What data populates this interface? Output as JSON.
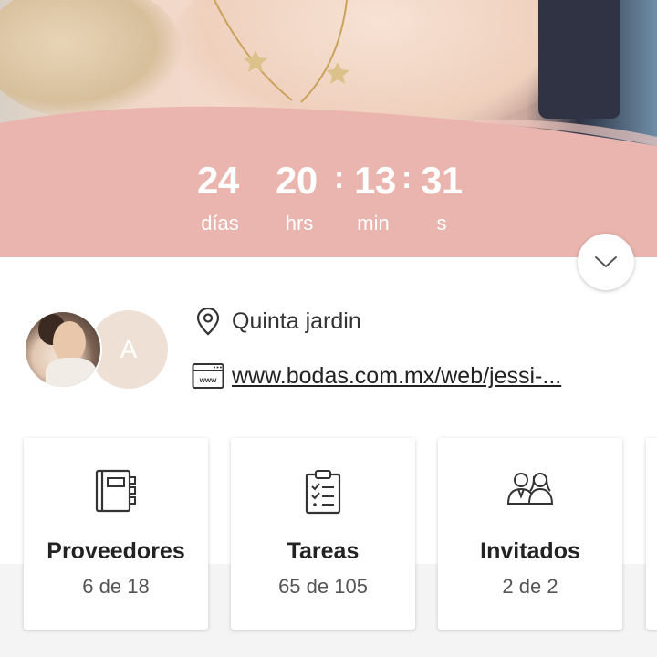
{
  "countdown": {
    "days": "24",
    "hours": "20",
    "minutes": "13",
    "seconds": "31",
    "separator": ":",
    "days_label": "días",
    "hours_label": "hrs",
    "minutes_label": "min",
    "seconds_label": "s"
  },
  "colors": {
    "accent_pink": "#eab5ae",
    "card_bg": "#ffffff",
    "page_bg": "#f4f4f4"
  },
  "couple": {
    "partner_initial": "A"
  },
  "venue": {
    "icon": "location-pin-icon",
    "name": "Quinta jardin"
  },
  "website": {
    "icon": "browser-www-icon",
    "url": "www.bodas.com.mx/web/jessi-..."
  },
  "cards": [
    {
      "icon": "notebook-icon",
      "title": "Proveedores",
      "count": "6 de 18"
    },
    {
      "icon": "checklist-clipboard-icon",
      "title": "Tareas",
      "count": "65 de 105"
    },
    {
      "icon": "guests-couple-icon",
      "title": "Invitados",
      "count": "2 de 2"
    }
  ]
}
